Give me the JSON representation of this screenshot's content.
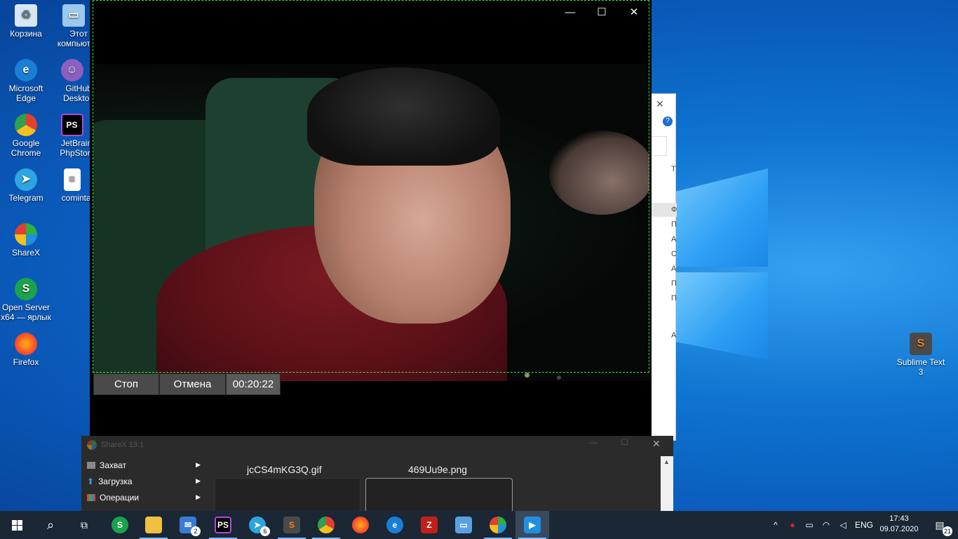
{
  "desktop": {
    "icons": [
      {
        "label": "Корзина",
        "icon": "recycle-bin-icon"
      },
      {
        "label": "Этот компьютер",
        "icon": "computer-icon"
      },
      {
        "label": "Microsoft Edge",
        "icon": "edge-icon"
      },
      {
        "label": "GitHub Desktop",
        "icon": "github-icon"
      },
      {
        "label": "Google Chrome",
        "icon": "chrome-icon"
      },
      {
        "label": "JetBrains PhpStorm",
        "icon": "phpstorm-icon"
      },
      {
        "label": "Telegram",
        "icon": "telegram-icon"
      },
      {
        "label": "comintan",
        "icon": "file-icon"
      },
      {
        "label": "ShareX",
        "icon": "sharex-icon"
      },
      {
        "label": "Open Server x64 — ярлык",
        "icon": "openserver-icon"
      },
      {
        "label": "Firefox",
        "icon": "firefox-icon"
      },
      {
        "label": "Sublime Text 3",
        "icon": "sublime-icon"
      }
    ]
  },
  "video_window": {
    "controls": {
      "minimize": "—",
      "maximize": "☐",
      "close": "✕"
    }
  },
  "recording": {
    "stop_label": "Стоп",
    "cancel_label": "Отмена",
    "timer": "00:20:22"
  },
  "sharex": {
    "title": "ShareX 13.1",
    "menu": [
      {
        "label": "Захват",
        "icon": "capture-icon"
      },
      {
        "label": "Загрузка",
        "icon": "upload-icon"
      },
      {
        "label": "Операции",
        "icon": "tools-icon"
      }
    ],
    "files": [
      "jcCS4mKG3Q.gif",
      "469Uu9e.png"
    ]
  },
  "right_window": {
    "letters": [
      "Т",
      "Ф",
      "П",
      "А",
      "С",
      "А",
      "П",
      "П",
      "А"
    ]
  },
  "taskbar": {
    "apps": [
      {
        "name": "openserver",
        "icon": "openserver-icon",
        "color": "#1aa34a"
      },
      {
        "name": "explorer",
        "icon": "folder-icon",
        "color": "#f0c040"
      },
      {
        "name": "mail",
        "icon": "mail-icon",
        "color": "#3a7bd5",
        "badge": "2"
      },
      {
        "name": "phpstorm",
        "icon": "phpstorm-icon",
        "color": "#b347d6"
      },
      {
        "name": "telegram",
        "icon": "telegram-icon",
        "color": "#2ca5e0",
        "badge": "6"
      },
      {
        "name": "sublime",
        "icon": "sublime-icon",
        "color": "#f08020"
      },
      {
        "name": "chrome",
        "icon": "chrome-icon",
        "color": "#e04030"
      },
      {
        "name": "firefox",
        "icon": "firefox-icon",
        "color": "#ff7020"
      },
      {
        "name": "edge",
        "icon": "edge-icon",
        "color": "#1a7fd4"
      },
      {
        "name": "filezilla",
        "icon": "filezilla-icon",
        "color": "#c0201a"
      },
      {
        "name": "remote",
        "icon": "remote-desktop-icon",
        "color": "#5aa0e0"
      },
      {
        "name": "sharex",
        "icon": "sharex-icon",
        "color": "#30b040"
      },
      {
        "name": "media",
        "icon": "media-player-icon",
        "color": "#2090e0"
      }
    ],
    "lang": "ENG",
    "time": "17:43",
    "date": "09.07.2020",
    "notifications": "21"
  }
}
